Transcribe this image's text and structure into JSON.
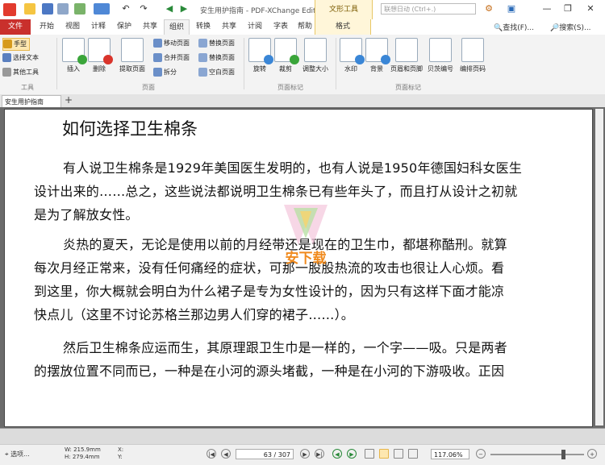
{
  "titlebar": {
    "title": "安生用护指南 - PDF-XChange Editor",
    "context_tab_group": "文形工具",
    "search_placeholder": "联想日动 (Ctrl+.)",
    "window_controls": [
      "minimize",
      "restore",
      "close"
    ]
  },
  "tabs": {
    "file": "文件",
    "items": [
      "开始",
      "视图",
      "计释",
      "保护",
      "共享",
      "组织",
      "转换",
      "共享",
      "计阅",
      "字表",
      "帮助",
      "格式"
    ],
    "active_index": 5,
    "right_find": "查找(F)...",
    "right_search": "搜索(S)..."
  },
  "ribbon": {
    "tools": [
      "手型",
      "选择文本",
      "其他工具"
    ],
    "tools_group": "工具",
    "insert_label": "插入",
    "delete_label": "删除",
    "extract_label": "提取页面",
    "page_small": [
      "移动页面",
      "合并页面",
      "拆分"
    ],
    "page_small2": [
      "替换页面",
      "替换页面",
      "空白页面"
    ],
    "pages_group": "页面",
    "rotate_label": "旋转",
    "crop_label": "裁剪",
    "resize_label": "调整大小",
    "page_markup_group": "页面标记",
    "watermark_label": "水印",
    "background_label": "背景",
    "header_label": "页眉和页脚",
    "bates_label": "贝茨编号",
    "numbering_label": "编排页码",
    "page_format_group": "页面标记"
  },
  "doc_tab": {
    "label": "安生用护指南"
  },
  "document": {
    "title": "如何选择卫生棉条",
    "paragraphs": [
      [
        "有人说卫生棉条是1929年美国医生发明的，也有人说是1950年德国妇科女医生",
        "设计出来的……总之，这些说法都说明卫生棉条已有些年头了，而且打从设计之初就",
        "是为了解放女性。"
      ],
      [
        "炎热的夏天，无论是使用以前的月经带还是现在的卫生巾，都堪称酷刑。就算",
        "每次月经正常来，没有任何痛经的症状，可那一股股热流的攻击也很让人心烦。看",
        "到这里，你大概就会明白为什么裙子是专为女性设计的，因为只有这样下面才能凉",
        "快点儿（这里不讨论苏格兰那边男人们穿的裙子……）。"
      ],
      [
        "然后卫生棉条应运而生，其原理跟卫生巾是一样的，一个字——吸。只是两者",
        "的摆放位置不同而已，一种是在小河的源头堵截，一种是在小河的下游吸收。正因"
      ]
    ],
    "watermark_text": "安下载"
  },
  "statusbar": {
    "select_label": "选项...",
    "width_label": "W: 215.9mm",
    "height_label": "H: 279.4mm",
    "x_label": "X:",
    "y_label": "Y:",
    "page_value": "63 / 307",
    "zoom_value": "117.06%"
  },
  "colors": {
    "file_tab": "#c9302c",
    "ribbon_bg": "#f3f3f3",
    "context_tab": "#fff6d9",
    "watermark_orange": "#f08a1d"
  }
}
